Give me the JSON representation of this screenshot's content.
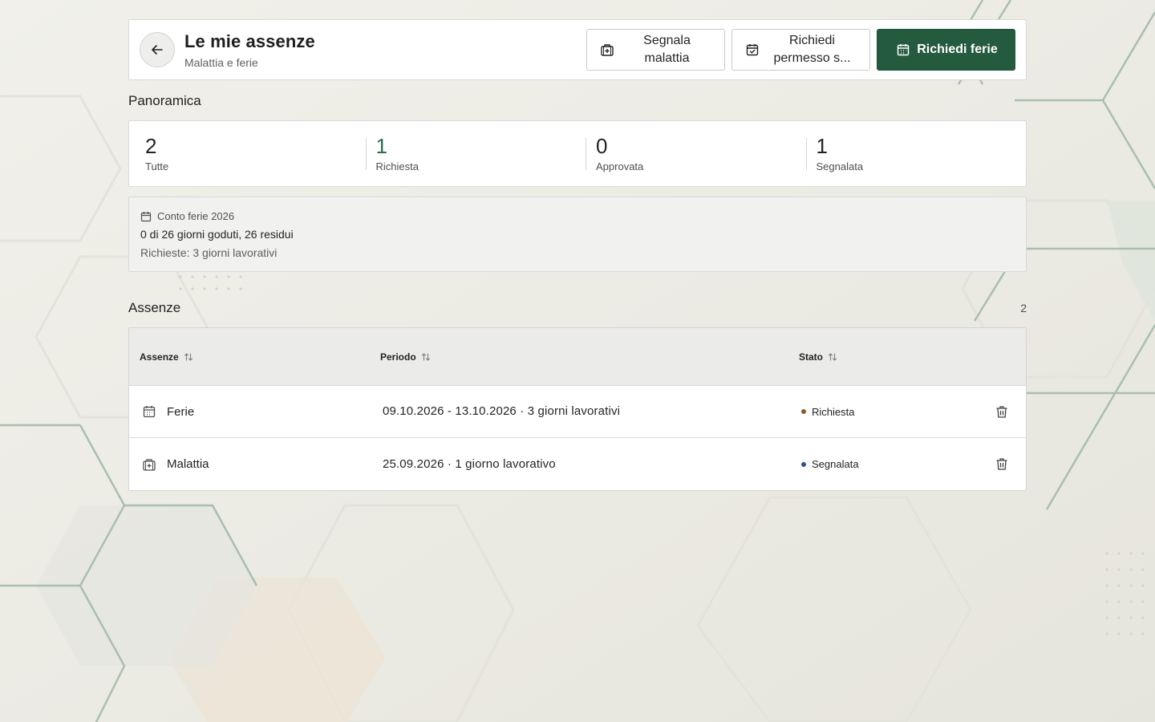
{
  "header": {
    "title": "Le mie assenze",
    "subtitle": "Malattia e ferie",
    "actions": {
      "report_sick": "Segnala malattia",
      "request_leave": "Richiedi permesso s...",
      "request_vacation": "Richiedi ferie"
    }
  },
  "overview": {
    "title": "Panoramica",
    "stats": [
      {
        "value": "2",
        "label": "Tutte"
      },
      {
        "value": "1",
        "label": "Richiesta"
      },
      {
        "value": "0",
        "label": "Approvata"
      },
      {
        "value": "1",
        "label": "Segnalata"
      }
    ]
  },
  "balance": {
    "title": "Conto ferie 2026",
    "summary": "0 di 26 giorni goduti, 26 residui",
    "requested": "Richieste: 3 giorni lavorativi"
  },
  "absences": {
    "title": "Assenze",
    "count": "2",
    "columns": {
      "type": "Assenze",
      "period": "Periodo",
      "status": "Stato"
    },
    "rows": [
      {
        "type": "Ferie",
        "icon": "calendar-icon",
        "period": "09.10.2026 - 13.10.2026 · 3 giorni lavorativi",
        "status": "Richiesta",
        "status_color": "#8a5a2b"
      },
      {
        "type": "Malattia",
        "icon": "medical-bag-icon",
        "period": "25.09.2026 · 1 giorno lavorativo",
        "status": "Segnalata",
        "status_color": "#2f4f8f"
      }
    ]
  },
  "colors": {
    "primary": "#245a3e",
    "accent_green": "#2c6b4a"
  }
}
